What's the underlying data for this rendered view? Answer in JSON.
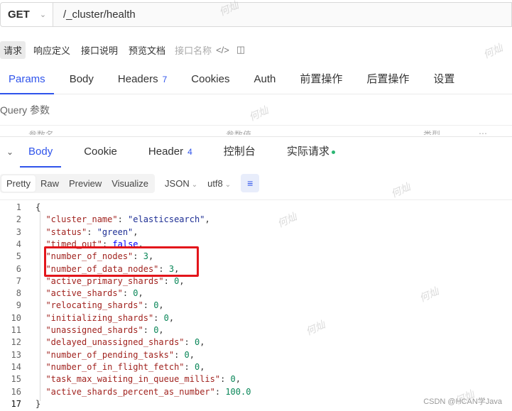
{
  "request": {
    "method": "GET",
    "url": "/_cluster/health"
  },
  "actions": {
    "items": [
      "请求",
      "响应定义",
      "接口说明",
      "预览文档"
    ],
    "placeholder": "接口名称",
    "code_icon": "</>"
  },
  "request_tabs": [
    {
      "label": "Params"
    },
    {
      "label": "Body"
    },
    {
      "label": "Headers",
      "badge": "7"
    },
    {
      "label": "Cookies"
    },
    {
      "label": "Auth"
    },
    {
      "label": "前置操作"
    },
    {
      "label": "后置操作"
    },
    {
      "label": "设置"
    }
  ],
  "query_label": "Query 参数",
  "query_columns": [
    "参数名",
    "参数值",
    "类型"
  ],
  "response_tabs": [
    {
      "label": "Body"
    },
    {
      "label": "Cookie"
    },
    {
      "label": "Header",
      "badge": "4"
    },
    {
      "label": "控制台"
    },
    {
      "label": "实际请求"
    }
  ],
  "view_modes": [
    "Pretty",
    "Raw",
    "Preview",
    "Visualize"
  ],
  "format_select": "JSON",
  "encoding_select": "utf8",
  "code_lines": [
    {
      "n": "1",
      "text": "{"
    },
    {
      "n": "2",
      "key": "\"cluster_name\"",
      "val": "\"elasticsearch\"",
      "type": "str"
    },
    {
      "n": "3",
      "key": "\"status\"",
      "val": "\"green\"",
      "type": "str"
    },
    {
      "n": "4",
      "key": "\"timed_out\"",
      "val": "false",
      "type": "bool"
    },
    {
      "n": "5",
      "key": "\"number_of_nodes\"",
      "val": "3",
      "type": "num"
    },
    {
      "n": "6",
      "key": "\"number_of_data_nodes\"",
      "val": "3",
      "type": "num"
    },
    {
      "n": "7",
      "key": "\"active_primary_shards\"",
      "val": "0",
      "type": "num"
    },
    {
      "n": "8",
      "key": "\"active_shards\"",
      "val": "0",
      "type": "num"
    },
    {
      "n": "9",
      "key": "\"relocating_shards\"",
      "val": "0",
      "type": "num"
    },
    {
      "n": "10",
      "key": "\"initializing_shards\"",
      "val": "0",
      "type": "num"
    },
    {
      "n": "11",
      "key": "\"unassigned_shards\"",
      "val": "0",
      "type": "num"
    },
    {
      "n": "12",
      "key": "\"delayed_unassigned_shards\"",
      "val": "0",
      "type": "num"
    },
    {
      "n": "13",
      "key": "\"number_of_pending_tasks\"",
      "val": "0",
      "type": "num"
    },
    {
      "n": "14",
      "key": "\"number_of_in_flight_fetch\"",
      "val": "0",
      "type": "num"
    },
    {
      "n": "15",
      "key": "\"task_max_waiting_in_queue_millis\"",
      "val": "0",
      "type": "num"
    },
    {
      "n": "16",
      "key": "\"active_shards_percent_as_number\"",
      "val": "100.0",
      "type": "num",
      "last": true
    },
    {
      "n": "17",
      "text": "}"
    }
  ],
  "watermark_text": "何灿",
  "credit": "CSDN @HCAN学Java"
}
